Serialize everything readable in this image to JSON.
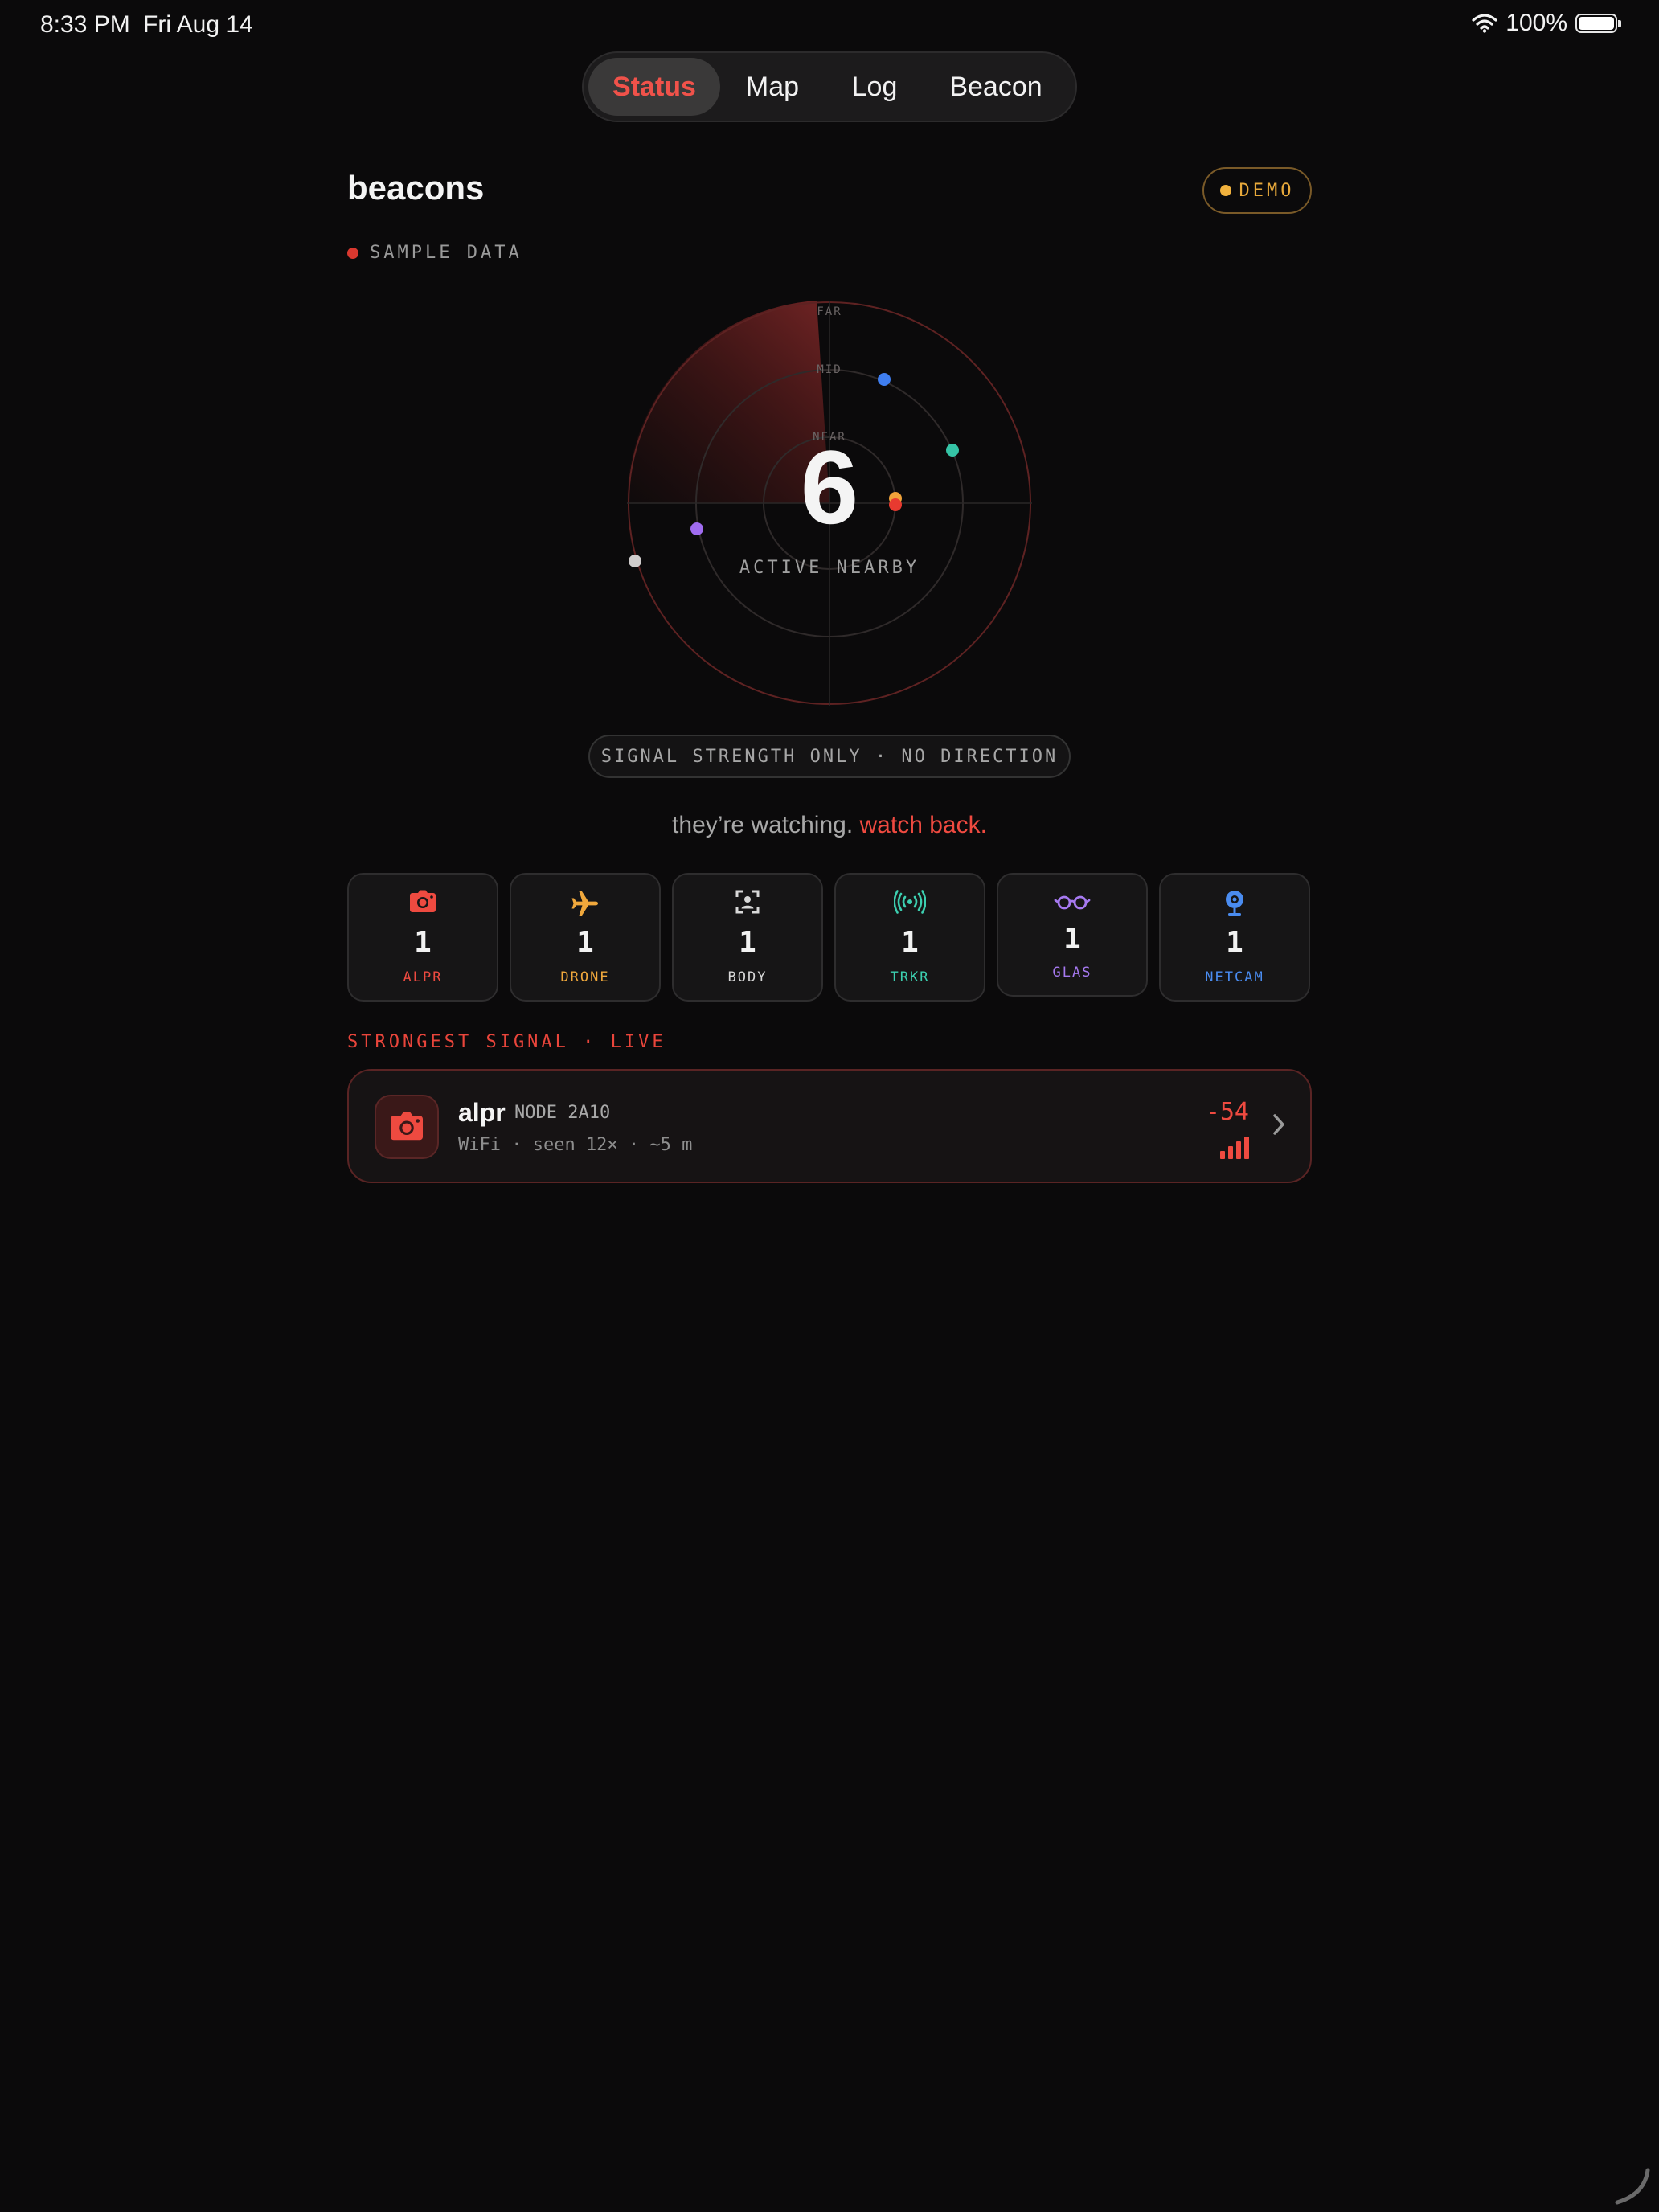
{
  "status_bar": {
    "time": "8:33 PM",
    "date": "Fri Aug 14",
    "battery": "100%"
  },
  "tabs": [
    {
      "label": "Status",
      "active": true
    },
    {
      "label": "Map",
      "active": false
    },
    {
      "label": "Log",
      "active": false
    },
    {
      "label": "Beacon",
      "active": false
    }
  ],
  "header": {
    "title": "beacons",
    "badge": "DEMO"
  },
  "sample_label": "SAMPLE DATA",
  "radar": {
    "rings": {
      "far": "FAR",
      "mid": "MID",
      "near": "NEAR"
    },
    "count": "6",
    "caption": "ACTIVE NEARBY",
    "note": "SIGNAL STRENGTH ONLY · NO DIRECTION"
  },
  "tagline": {
    "lead": "they’re watching.",
    "accent": "watch back."
  },
  "categories": [
    {
      "label": "ALPR",
      "count": "1",
      "color": "#ee4a40",
      "icon": "camera-icon"
    },
    {
      "label": "DRONE",
      "count": "1",
      "color": "#f0a83c",
      "icon": "airplane-icon"
    },
    {
      "label": "BODY",
      "count": "1",
      "color": "#d8d8d8",
      "icon": "body-cam-icon"
    },
    {
      "label": "TRKR",
      "count": "1",
      "color": "#3ccfb0",
      "icon": "broadcast-icon"
    },
    {
      "label": "GLAS",
      "count": "1",
      "color": "#a679f0",
      "icon": "glasses-icon"
    },
    {
      "label": "NETCAM",
      "count": "1",
      "color": "#4a8cf0",
      "icon": "webcam-icon"
    }
  ],
  "strongest": {
    "section_label": "STRONGEST SIGNAL · LIVE",
    "name": "alpr",
    "node": "NODE 2A10",
    "meta": "WiFi · seen 12× · ~5 m",
    "rssi": "-54",
    "icon": "camera-icon"
  }
}
